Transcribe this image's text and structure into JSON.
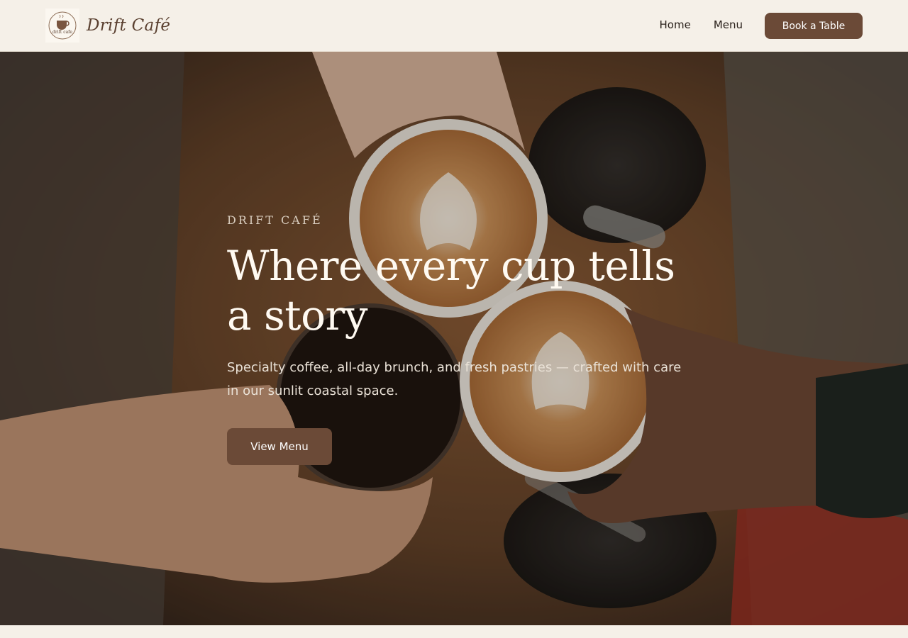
{
  "brand": {
    "name": "Drift Café",
    "logo_text": "drift cafe",
    "logo_icon": "coffee-cup-icon"
  },
  "nav": {
    "home": "Home",
    "menu": "Menu",
    "book": "Book a Table"
  },
  "hero": {
    "eyebrow": "DRIFT CAFÉ",
    "headline": "Where every cup tells a story",
    "subtext": "Specialty coffee, all-day brunch, and fresh pastries — crafted with care in our sunlit coastal space.",
    "cta": "View Menu",
    "image": "overhead photo of hands clinking latte cups over a wooden table"
  },
  "colors": {
    "accent": "#6b4a37",
    "background": "#f5f0e8",
    "text": "#2a211b"
  }
}
